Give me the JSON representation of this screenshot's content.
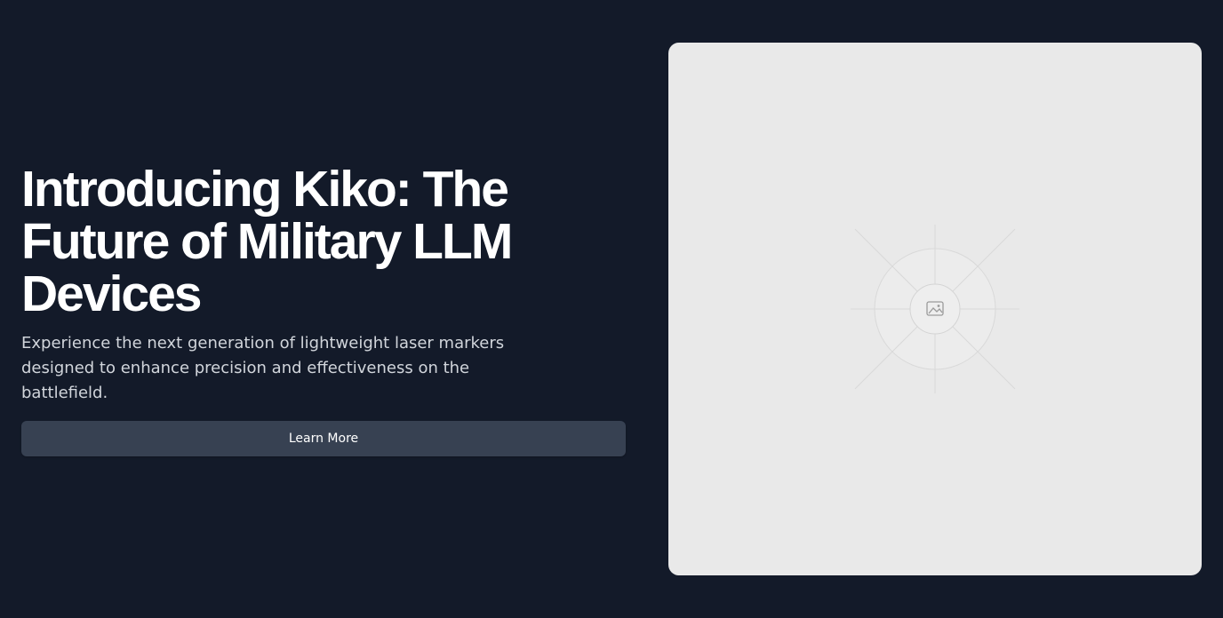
{
  "hero": {
    "headline": "Introducing Kiko: The Future of Military LLM Devices",
    "subtext": "Experience the next generation of lightweight laser markers designed to enhance precision and effectiveness on the battlefield.",
    "cta_label": "Learn More"
  },
  "media": {
    "placeholder_icon": "image-icon"
  },
  "colors": {
    "background": "#131a29",
    "button": "#374152",
    "card": "#e9e9e9"
  }
}
